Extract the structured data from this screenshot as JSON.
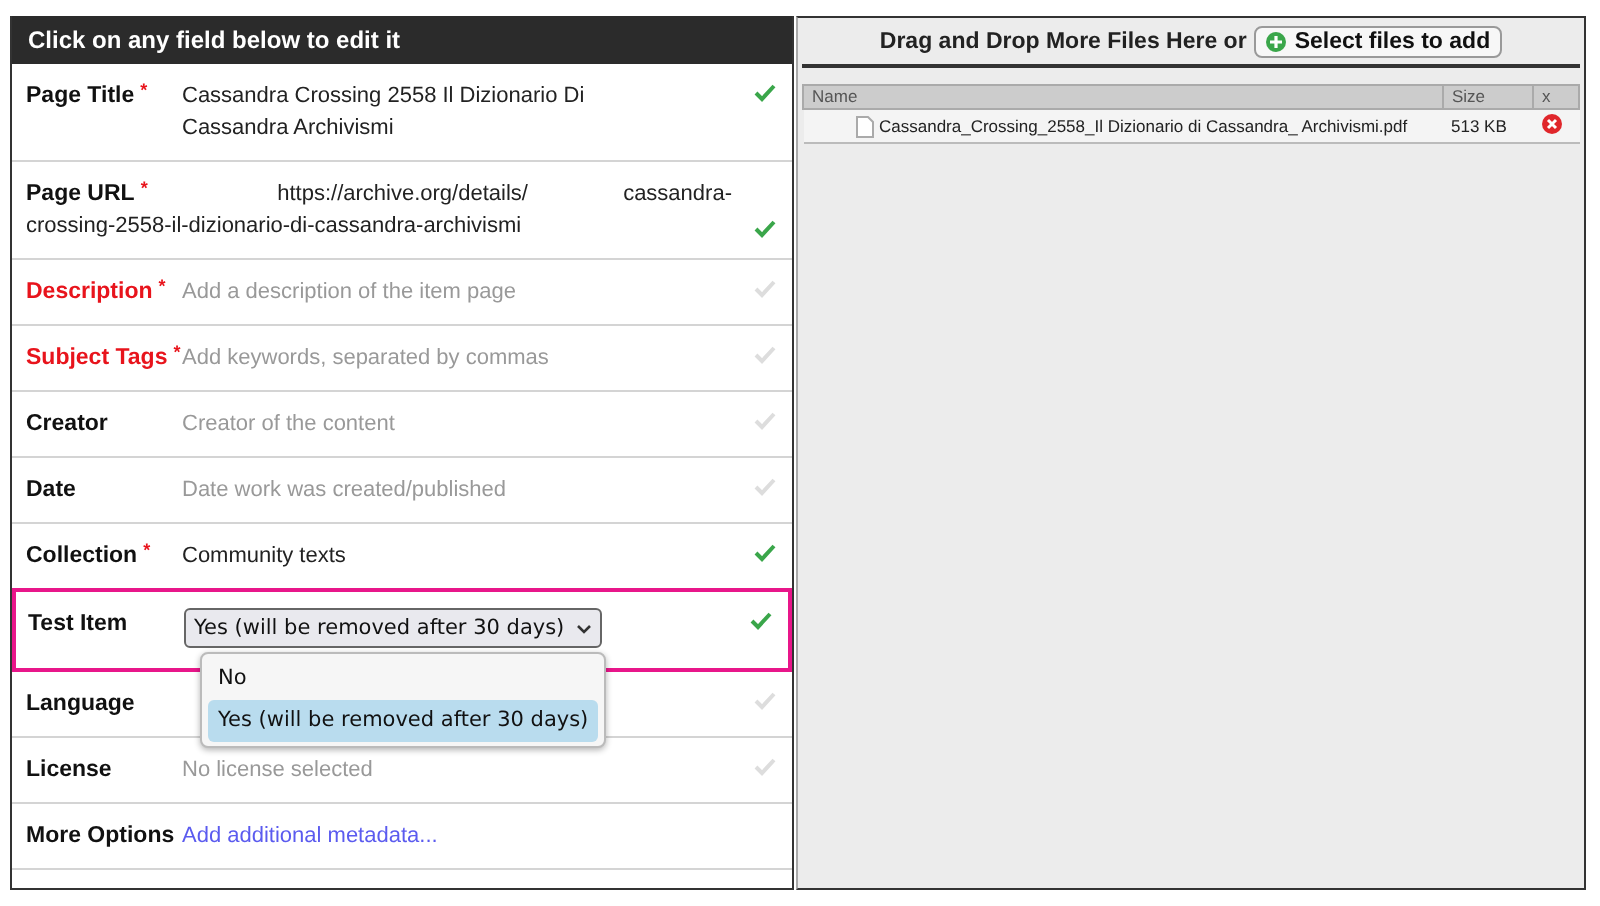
{
  "form": {
    "header": "Click on any field below to edit it",
    "fields": [
      {
        "label": "Page Title",
        "required_mark": "*",
        "alert": false,
        "highlighted": false,
        "kind": "text",
        "value": "Cassandra Crossing 2558 Il Dizionario Di Cassandra Archivismi",
        "valid": true
      },
      {
        "label": "Page URL",
        "required_mark": "*",
        "alert": false,
        "highlighted": false,
        "kind": "url",
        "value_parts": [
          "https://archive.org/details/",
          "cassandra-",
          "crossing-2558-il-dizionario-di-cassandra-archivismi"
        ],
        "valid": true
      },
      {
        "label": "Description",
        "required_mark": "*",
        "alert": true,
        "highlighted": false,
        "kind": "text",
        "placeholder": "Add a description of the item page",
        "valid": false
      },
      {
        "label": "Subject Tags",
        "required_mark": "*",
        "alert": true,
        "highlighted": false,
        "kind": "text",
        "placeholder": "Add keywords, separated by commas",
        "valid": false
      },
      {
        "label": "Creator",
        "alert": false,
        "highlighted": false,
        "kind": "text",
        "placeholder": "Creator of the content",
        "valid": false
      },
      {
        "label": "Date",
        "alert": false,
        "highlighted": false,
        "kind": "text",
        "placeholder": "Date work was created/published",
        "valid": false
      },
      {
        "label": "Collection",
        "required_mark": "*",
        "alert": false,
        "highlighted": false,
        "kind": "text",
        "value": "Community texts",
        "valid": true
      },
      {
        "label": "Test Item",
        "alert": false,
        "highlighted": true,
        "kind": "select",
        "value": "Yes (will be removed after 30 days)",
        "expanded": true,
        "options": [
          {
            "label": "No",
            "selected": false
          },
          {
            "label": "Yes (will be removed after 30 days)",
            "selected": true
          }
        ],
        "valid": true
      },
      {
        "label": "Language",
        "alert": false,
        "highlighted": false,
        "kind": "text",
        "valid": false
      },
      {
        "label": "License",
        "alert": false,
        "highlighted": false,
        "kind": "text",
        "placeholder": "No license selected",
        "valid": false
      },
      {
        "label": "More Options",
        "alert": false,
        "highlighted": false,
        "kind": "link",
        "value": "Add additional metadata..."
      }
    ]
  },
  "upload": {
    "prompt": "Drag and Drop More Files Here or",
    "button": "Select files to add",
    "table": {
      "columns": [
        "Name",
        "Size",
        "x"
      ],
      "rows": [
        {
          "name": "Cassandra_Crossing_2558_Il Dizionario di Cassandra_ Archivismi.pdf",
          "size": "513 KB"
        }
      ]
    }
  }
}
